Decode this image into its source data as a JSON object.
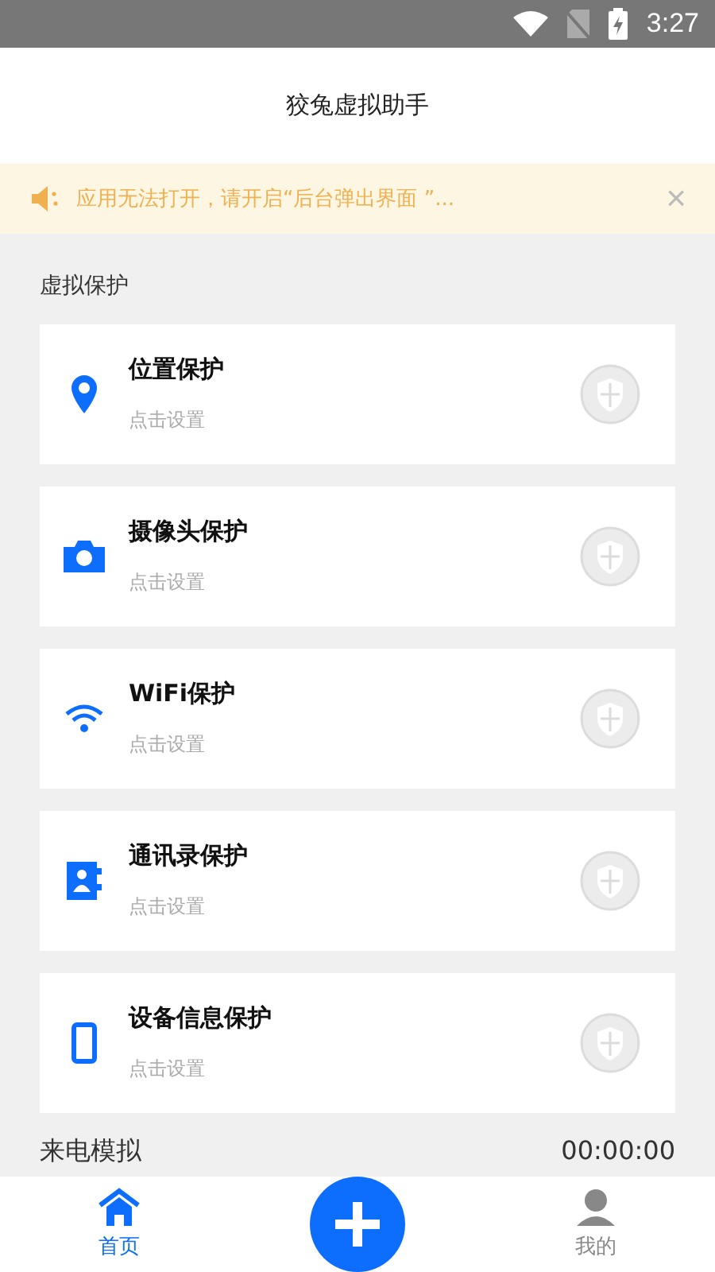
{
  "status_bar": {
    "time": "3:27"
  },
  "header": {
    "title": "狡兔虚拟助手"
  },
  "notice": {
    "text": "应用无法打开，请开启“后台弹出界面 ”...",
    "close": "×"
  },
  "section": {
    "title": "虚拟保护"
  },
  "items": [
    {
      "kind": "location",
      "title": "位置保护",
      "subtitle": "点击设置",
      "enabled": false
    },
    {
      "kind": "camera",
      "title": "摄像头保护",
      "subtitle": "点击设置",
      "enabled": false
    },
    {
      "kind": "wifi",
      "title": "WiFi保护",
      "subtitle": "点击设置",
      "enabled": false
    },
    {
      "kind": "contacts",
      "title": "通讯录保护",
      "subtitle": "点击设置",
      "enabled": false
    },
    {
      "kind": "device",
      "title": "设备信息保护",
      "subtitle": "点击设置",
      "enabled": false
    }
  ],
  "next_section": {
    "title": "来电模拟",
    "time": "00:00:00"
  },
  "tabs": [
    {
      "kind": "home",
      "label": "首页",
      "selected": true
    },
    {
      "kind": "add"
    },
    {
      "kind": "profile",
      "label": "我的",
      "selected": false
    }
  ]
}
